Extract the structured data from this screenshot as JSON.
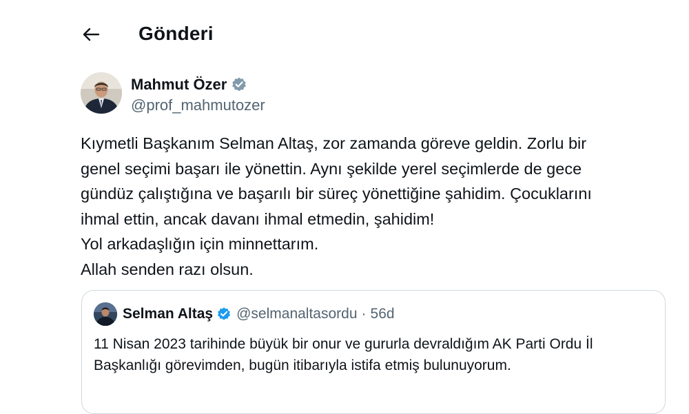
{
  "header": {
    "back_icon": "arrow-left-icon",
    "title": "Gönderi"
  },
  "author": {
    "name": "Mahmut Özer",
    "handle": "@prof_mahmutozer",
    "verified_icon": "verified-badge-icon",
    "verified_color": "#829aab"
  },
  "tweet": {
    "text": "Kıymetli Başkanım Selman Altaş, zor zamanda göreve geldin. Zorlu bir\ngenel seçimi başarı ile yönettin. Aynı şekilde yerel seçimlerde de gece\ngündüz çalıştığına ve başarılı bir süreç yönettiğine şahidim. Çocuklarını\nihmal ettin, ancak davanı ihmal etmedin, şahidim!\nYol arkadaşlığın için minnettarım.\nAllah senden razı olsun."
  },
  "quoted_tweet": {
    "name": "Selman Altaş",
    "verified_icon": "verified-badge-icon",
    "verified_color": "#1d9bf0",
    "handle": "@selmanaltasordu",
    "separator": "·",
    "time": "56d",
    "text": "11 Nisan 2023 tarihinde büyük bir onur ve gururla devraldığım AK Parti Ordu İl\nBaşkanlığı görevimden, bugün itibarıyla istifa etmiş bulunuyorum."
  }
}
